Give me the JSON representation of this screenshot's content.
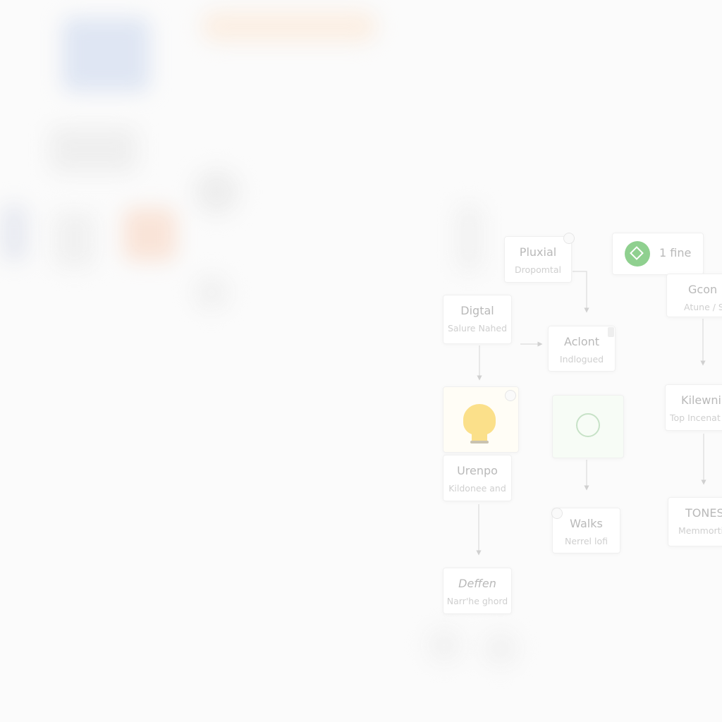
{
  "nodes": [
    {
      "title": "Pluxial",
      "subtitle": "Dropomtal"
    },
    {
      "title": "1 fine",
      "subtitle": ""
    },
    {
      "title": "Gcon",
      "subtitle": "Atune / S"
    },
    {
      "title": "Digtal",
      "subtitle": "Salure Nahed"
    },
    {
      "title": "Aclont",
      "subtitle": "Indlogued"
    },
    {
      "title": "Urenpo",
      "subtitle": "Kildonee and"
    },
    {
      "title": "Walks",
      "subtitle": "Nerrel lofi"
    },
    {
      "title": "Kilewnii",
      "subtitle": "Top Incenat"
    },
    {
      "title": "TONES",
      "subtitle": "Memmortic"
    },
    {
      "title": "Deffen",
      "subtitle": "Narr'he ghord"
    }
  ],
  "colors": {
    "accent_green": "#8fd08f",
    "bulb_yellow": "#fbe08a",
    "background": "#fbfbfb"
  },
  "icons": [
    "download-diamond-icon",
    "lightbulb-icon",
    "recycle-icon",
    "chat-icon",
    "lock-icon",
    "pin-icon"
  ]
}
